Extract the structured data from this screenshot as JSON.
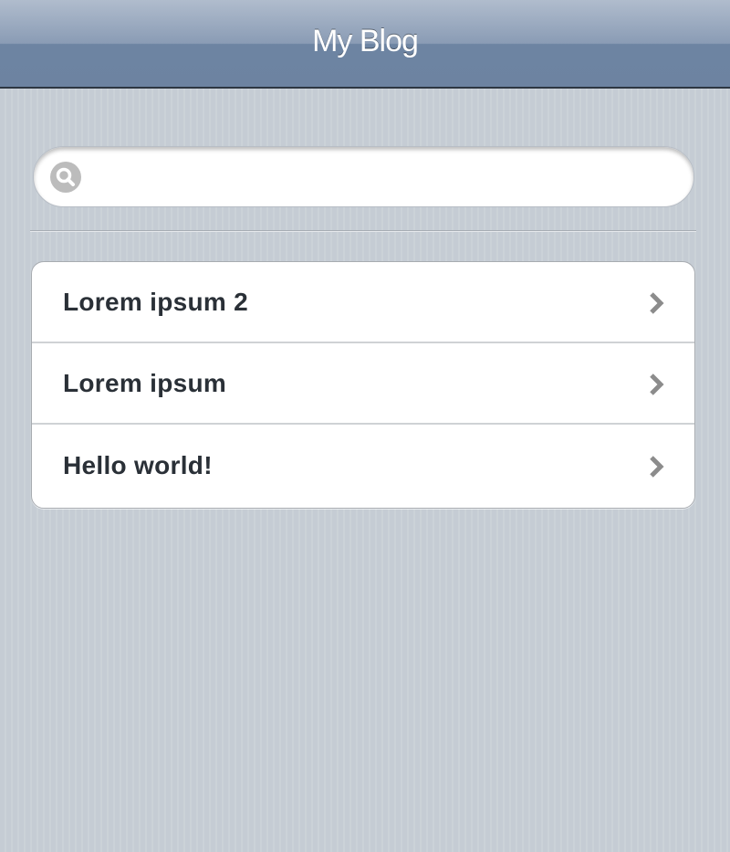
{
  "header": {
    "title": "My Blog"
  },
  "search": {
    "placeholder": "",
    "value": "",
    "icon": "search-icon"
  },
  "posts": [
    {
      "label": "Lorem ipsum 2",
      "icon": "chevron-right-icon"
    },
    {
      "label": "Lorem ipsum",
      "icon": "chevron-right-icon"
    },
    {
      "label": "Hello world!",
      "icon": "chevron-right-icon"
    }
  ],
  "colors": {
    "header_top": "#b0bccd",
    "header_bottom": "#6d83a1",
    "background": "#c5ccd4",
    "item_text": "#2a3037",
    "chevron": "#8c8c8c"
  }
}
